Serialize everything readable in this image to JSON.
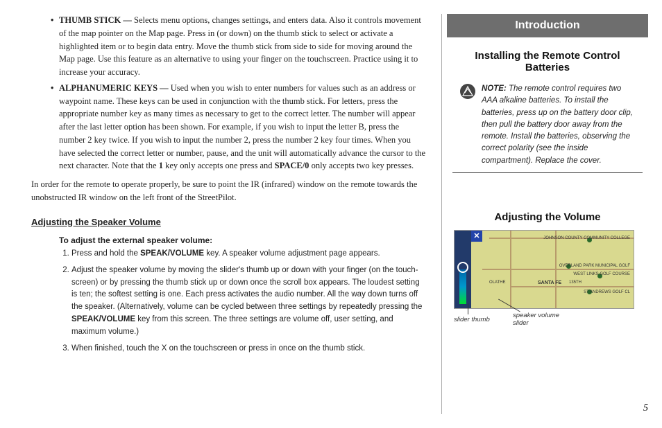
{
  "main": {
    "bullets": [
      {
        "label": "THUMB STICK — ",
        "text": "Selects menu options, changes settings, and enters data. Also it controls movement of the map pointer on the Map page. Press in (or down) on the thumb stick to select or activate a highlighted item or to begin data entry. Move the thumb stick from side to side for moving around the Map page. Use this feature as an alternative to using your finger on the touchscreen. Practice using it to increase your accuracy."
      },
      {
        "label": "ALPHANUMERIC KEYS — ",
        "text_before": "Used when you wish to enter numbers for values such as an address or waypoint name. These keys can be used in conjunction with the thumb stick. For letters, press the appropriate number key as many times as necessary to get to the correct letter. The number will appear after the last letter option has been shown. For example, if you wish to input the letter B, press the number 2 key twice. If you wish to input the number 2, press the number 2 key four times. When you have selected the correct letter or number, pause, and the unit will automatically advance the cursor to the next character. Note that the ",
        "bold1": "1",
        "text_mid": " key only accepts one press and ",
        "bold2": "SPACE/0",
        "text_after": " only accepts two key presses."
      }
    ],
    "after_bullets": "In order for the remote to operate properly, be sure to point the IR (infrared) window on the remote towards the unobstructed IR window on the left front of the StreetPilot.",
    "subheading": "Adjusting the Speaker Volume",
    "sub_sub": "To adjust the external speaker volume:",
    "steps": [
      {
        "pre": "Press and hold the ",
        "b": "SPEAK/VOLUME",
        "post": " key. A speaker volume adjustment page appears."
      },
      {
        "pre": "Adjust the speaker volume by moving the slider's thumb up or down with your finger (on the touch-screen) or by pressing the thumb stick up or down once the scroll box appears. The loudest setting is ten; the softest setting is one. Each press activates the audio number. All the way down turns off the speaker. (Alternatively, volume can be cycled between three settings by repeatedly pressing the ",
        "b": "SPEAK/VOLUME",
        "post": " key from this screen. The three settings are volume off, user setting, and maximum volume.)"
      },
      {
        "pre": "When finished, touch the X on the touchscreen or press in once on the thumb stick.",
        "b": "",
        "post": ""
      }
    ]
  },
  "sidebar": {
    "header": "Introduction",
    "section1": "Installing the Remote Control Batteries",
    "note_label": "NOTE:",
    "note_text": " The remote control requires two AAA alkaline batteries. To install the batteries, press up on the battery door clip, then pull the battery door away from the remote. Install the batteries, observing the correct polarity (see the inside compartment). Replace the cover.",
    "section2": "Adjusting the Volume",
    "map": {
      "label1": "JOHNSON COUNTY COMMUNITY COLLEGE",
      "label2": "OVERLAND PARK MUNICIPAL GOLF",
      "label3": "ST ANDREWS GOLF CL",
      "label4": "SANTA FE",
      "label5": "135TH",
      "label6": "OLATHE",
      "label_westlinks": "WEST LINKS GOLF COURSE",
      "close": "✕"
    },
    "captions": {
      "c1": "slider thumb",
      "c2": "speaker volume slider"
    }
  },
  "page_number": "5"
}
